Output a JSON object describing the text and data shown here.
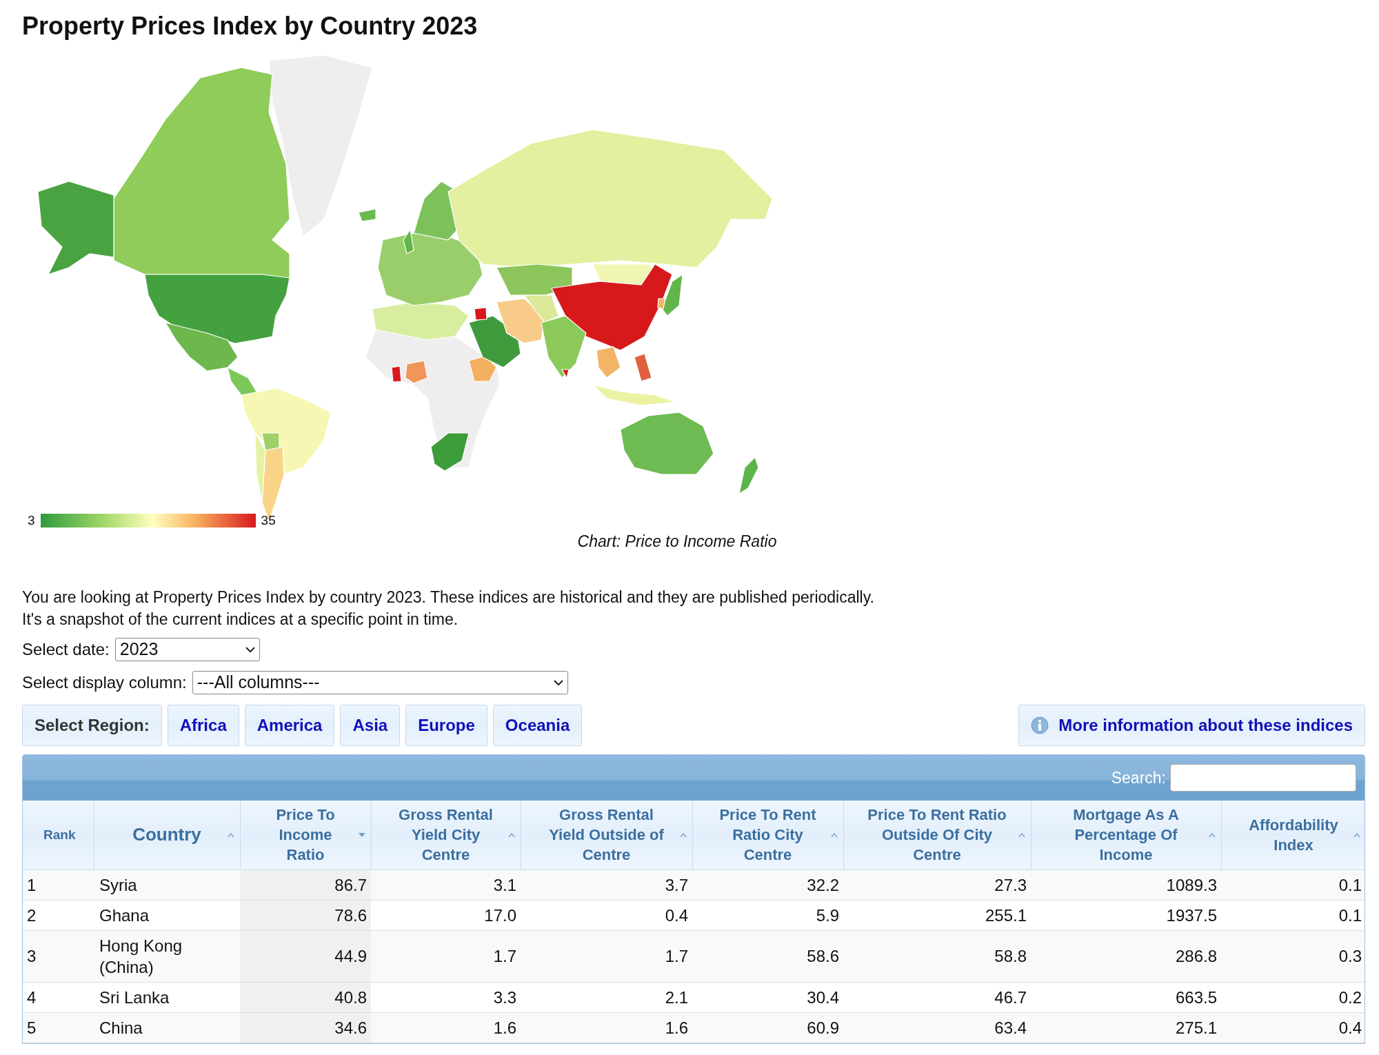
{
  "title": "Property Prices Index by Country 2023",
  "map": {
    "legend_min": "3",
    "legend_max": "35",
    "caption": "Chart: Price to Income Ratio"
  },
  "intro": [
    "You are looking at Property Prices Index by country 2023. These indices are historical and they are published periodically.",
    "It's a snapshot of the current indices at a specific point in time."
  ],
  "date_select": {
    "label": "Select date:",
    "value": "2023"
  },
  "column_select": {
    "label": "Select display column:",
    "value": "---All columns---"
  },
  "regions": {
    "label": "Select Region:",
    "items": [
      "Africa",
      "America",
      "Asia",
      "Europe",
      "Oceania"
    ]
  },
  "info_link": "More information about these indices",
  "table": {
    "search_label": "Search:",
    "columns": [
      {
        "label": "Rank",
        "sortable": false,
        "selected": false
      },
      {
        "label": "Country",
        "sortable": true,
        "selected": false
      },
      {
        "label": "Price To Income Ratio",
        "sortable": true,
        "selected": true
      },
      {
        "label": "Gross Rental Yield City Centre",
        "sortable": true,
        "selected": false
      },
      {
        "label": "Gross Rental Yield Outside of Centre",
        "sortable": true,
        "selected": false
      },
      {
        "label": "Price To Rent Ratio City Centre",
        "sortable": true,
        "selected": false
      },
      {
        "label": "Price To Rent Ratio Outside Of City Centre",
        "sortable": true,
        "selected": false
      },
      {
        "label": "Mortgage As A Percentage Of Income",
        "sortable": true,
        "selected": false
      },
      {
        "label": "Affordability Index",
        "sortable": true,
        "selected": false
      }
    ],
    "rows": [
      [
        "1",
        "Syria",
        "86.7",
        "3.1",
        "3.7",
        "32.2",
        "27.3",
        "1089.3",
        "0.1"
      ],
      [
        "2",
        "Ghana",
        "78.6",
        "17.0",
        "0.4",
        "5.9",
        "255.1",
        "1937.5",
        "0.1"
      ],
      [
        "3",
        "Hong Kong (China)",
        "44.9",
        "1.7",
        "1.7",
        "58.6",
        "58.8",
        "286.8",
        "0.3"
      ],
      [
        "4",
        "Sri Lanka",
        "40.8",
        "3.3",
        "2.1",
        "30.4",
        "46.7",
        "663.5",
        "0.2"
      ],
      [
        "5",
        "China",
        "34.6",
        "1.6",
        "1.6",
        "60.9",
        "63.4",
        "275.1",
        "0.4"
      ]
    ]
  }
}
